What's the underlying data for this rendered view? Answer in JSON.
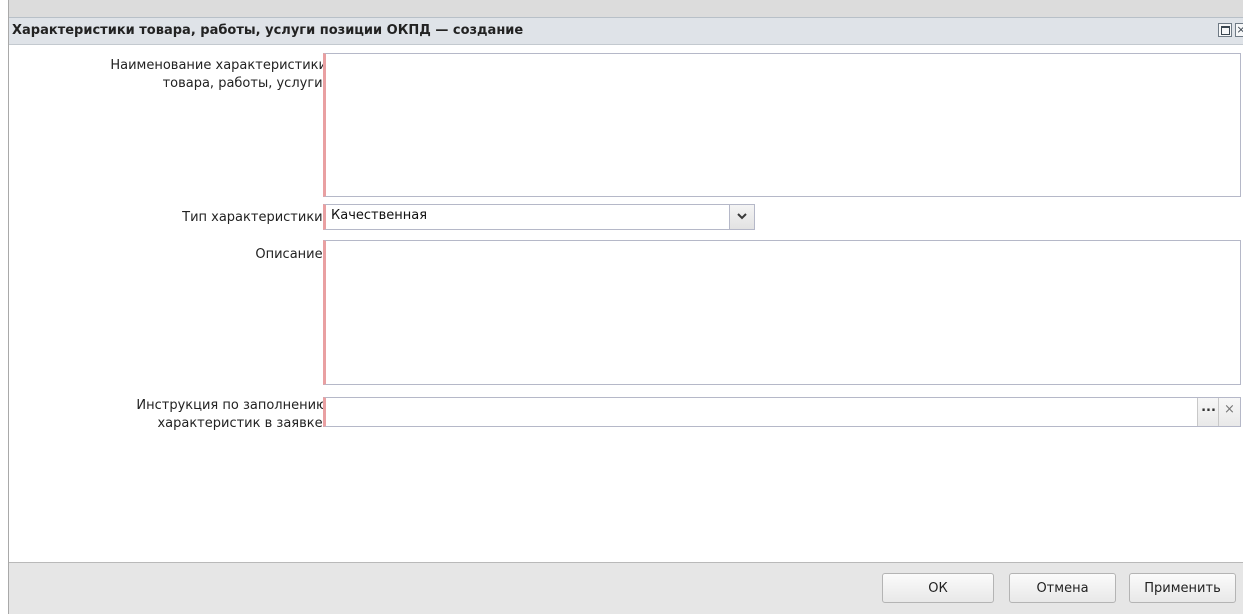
{
  "window": {
    "title": "Характеристики товара, работы, услуги позиции ОКПД — создание",
    "close_glyph": "×"
  },
  "form": {
    "name_label_line1": "Наименование характеристики",
    "name_label_line2": "товара, работы, услуги:",
    "name_value": "",
    "type_label": "Тип характеристики:",
    "type_value": "Качественная",
    "description_label": "Описание:",
    "description_value": "",
    "instruction_label_line1": "Инструкция по заполнению",
    "instruction_label_line2": "характеристик в заявке:",
    "instruction_value": "",
    "lookup_glyph": "...",
    "clear_glyph": "×"
  },
  "footer": {
    "ok_label": "ОК",
    "cancel_label": "Отмена",
    "apply_label": "Применить"
  },
  "colors": {
    "required_marker": "#e9a0a2",
    "titlebar_bg": "#dfe3e8",
    "footer_bg": "#e6e6e6"
  },
  "icons": {
    "window_maximize": "maximize-icon",
    "window_close": "close-icon",
    "combo_arrow": "chevron-down-icon",
    "lookup": "ellipsis-icon",
    "clear": "clear-icon"
  }
}
